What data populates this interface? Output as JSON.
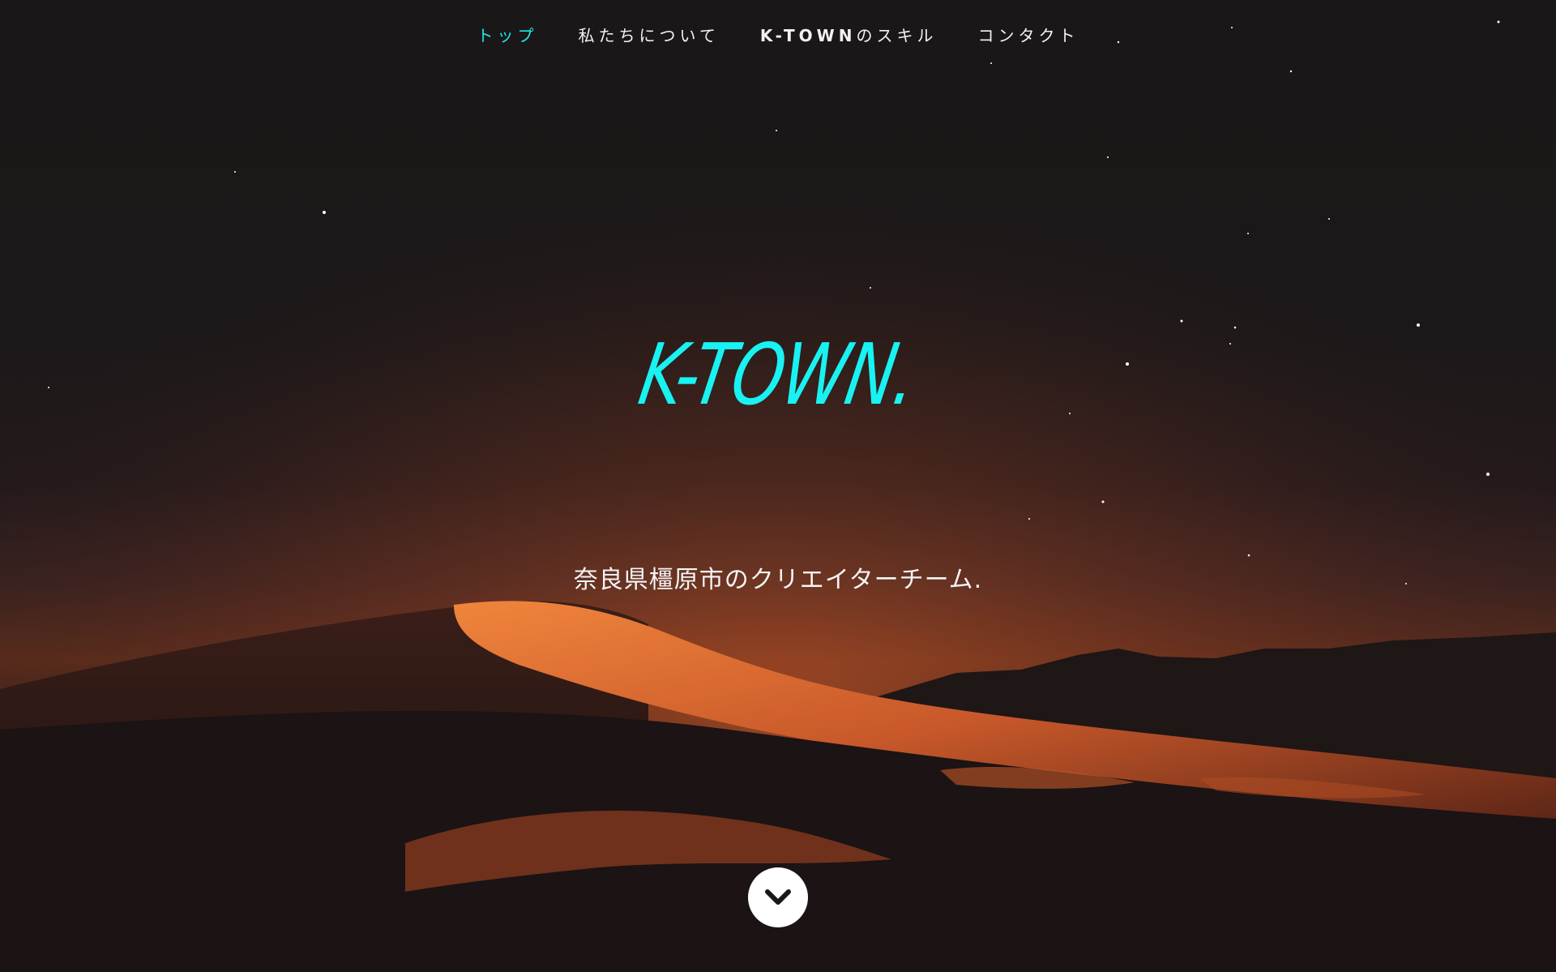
{
  "nav": {
    "items": [
      {
        "label": "トップ",
        "active": true
      },
      {
        "label": "私たちについて",
        "active": false
      },
      {
        "label_bold": "K-TOWN",
        "label_rest": "のスキル",
        "active": false
      },
      {
        "label": "コンタクト",
        "active": false
      }
    ]
  },
  "hero": {
    "logo": "K-TOWN.",
    "tagline": "奈良県橿原市のクリエイターチーム.",
    "scroll_icon": "chevron-down-icon"
  },
  "colors": {
    "accent": "#19f2f2",
    "text": "#f2f2f2",
    "sky": "#1a1718",
    "dune_glow": "#e06a2a"
  }
}
